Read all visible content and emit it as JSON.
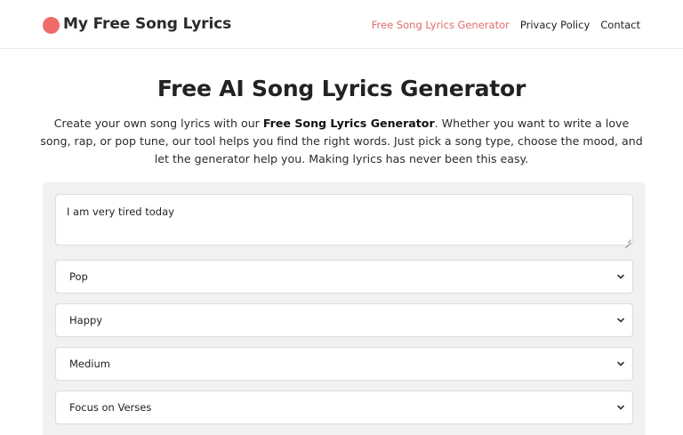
{
  "header": {
    "site_title": "My Free Song Lyrics",
    "nav": [
      {
        "label": "Free Song Lyrics Generator",
        "active": true
      },
      {
        "label": "Privacy Policy",
        "active": false
      },
      {
        "label": "Contact",
        "active": false
      }
    ]
  },
  "main": {
    "title": "Free AI Song Lyrics Generator",
    "intro_prefix": "Create your own song lyrics with our ",
    "intro_bold": "Free Song Lyrics Generator",
    "intro_suffix": ". Whether you want to write a love song, rap, or pop tune, our tool helps you find the right words. Just pick a song type, choose the mood, and let the generator help you. Making lyrics has never been this easy."
  },
  "form": {
    "topic_value": "I am very tired today",
    "genre_value": "Pop",
    "mood_value": "Happy",
    "length_value": "Medium",
    "focus_value": "Focus on Verses"
  },
  "colors": {
    "accent": "#f06a6a",
    "nav_active": "#e36a6a",
    "panel_bg": "#f1f1f1"
  },
  "icons": {
    "select_arrow": "chevron-down-icon",
    "logo": "red-circle-logo"
  }
}
